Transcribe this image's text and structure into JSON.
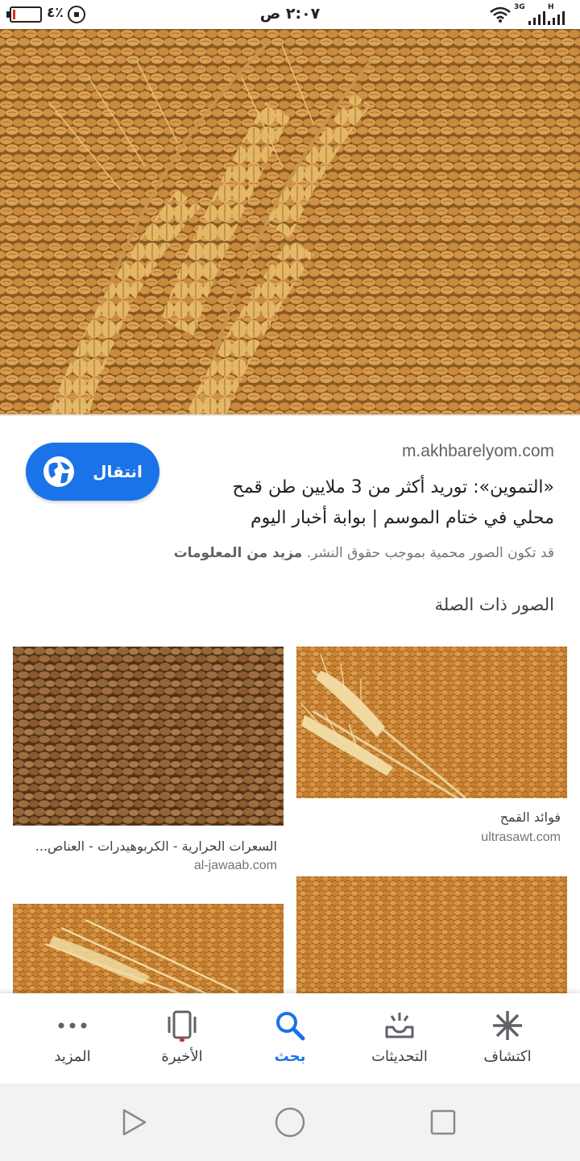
{
  "status_bar": {
    "battery_percent": "٤٪",
    "time": "٢:٠٧ ص",
    "network": "3G",
    "network_h": "H"
  },
  "result": {
    "source": "m.akhbarelyom.com",
    "title": "«التموين»: توريد أكثر من 3 ملايين طن قمح محلي في ختام الموسم | بوابة أخبار اليوم",
    "visit_label": "انتقال",
    "copyright_text": "قد تكون الصور محمية بموجب حقوق النشر.",
    "more_info": "مزيد من المعلومات"
  },
  "related": {
    "heading": "الصور ذات الصلة",
    "items": [
      {
        "caption": "فوائد القمح",
        "source": "ultrasawt.com"
      },
      {
        "caption": "السعرات الحرارية - الكربوهيدرات - العناص...",
        "source": "al-jawaab.com"
      }
    ]
  },
  "bottom_nav": {
    "items": [
      {
        "label": "اكتشاف",
        "icon": "asterisk-icon"
      },
      {
        "label": "التحديثات",
        "icon": "updates-tray-icon"
      },
      {
        "label": "بحث",
        "icon": "search-icon"
      },
      {
        "label": "الأخيرة",
        "icon": "recent-cards-icon"
      },
      {
        "label": "المزيد",
        "icon": "more-dots-icon"
      }
    ],
    "active": "بحث",
    "accent_color": "#1a73e8"
  },
  "system_nav": {
    "buttons": [
      "back-triangle-icon",
      "home-circle-icon",
      "recents-square-icon"
    ]
  }
}
